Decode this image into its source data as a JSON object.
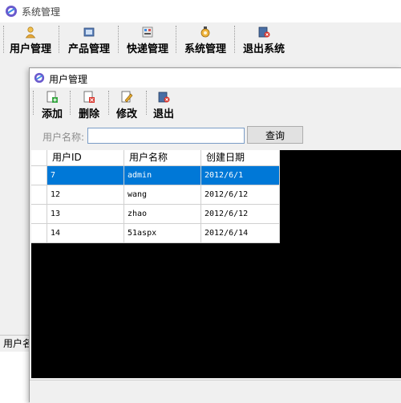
{
  "main": {
    "title": "系统管理",
    "toolbar": [
      {
        "label": "用户管理",
        "icon": "user-icon"
      },
      {
        "label": "产品管理",
        "icon": "product-icon"
      },
      {
        "label": "快递管理",
        "icon": "express-icon"
      },
      {
        "label": "系统管理",
        "icon": "system-icon"
      },
      {
        "label": "退出系统",
        "icon": "exit-system-icon"
      }
    ],
    "status_text": "用户名"
  },
  "child": {
    "title": "用户管理",
    "toolbar": [
      {
        "label": "添加",
        "icon": "add-icon"
      },
      {
        "label": "删除",
        "icon": "delete-icon"
      },
      {
        "label": "修改",
        "icon": "edit-icon"
      },
      {
        "label": "退出",
        "icon": "exit-icon"
      }
    ],
    "search": {
      "label": "用户名称:",
      "value": "",
      "placeholder": "",
      "button_label": "查询"
    },
    "table": {
      "columns": [
        "用户ID",
        "用户名称",
        "创建日期"
      ],
      "rows": [
        [
          "7",
          "admin",
          "2012/6/1"
        ],
        [
          "12",
          "wang",
          "2012/6/12"
        ],
        [
          "13",
          "zhao",
          "2012/6/12"
        ],
        [
          "14",
          "51aspx",
          "2012/6/14"
        ]
      ],
      "selected_row": 0
    }
  },
  "colors": {
    "selection": "#0078d7",
    "grid_background": "#000000",
    "window_background": "#f0f0f0"
  }
}
